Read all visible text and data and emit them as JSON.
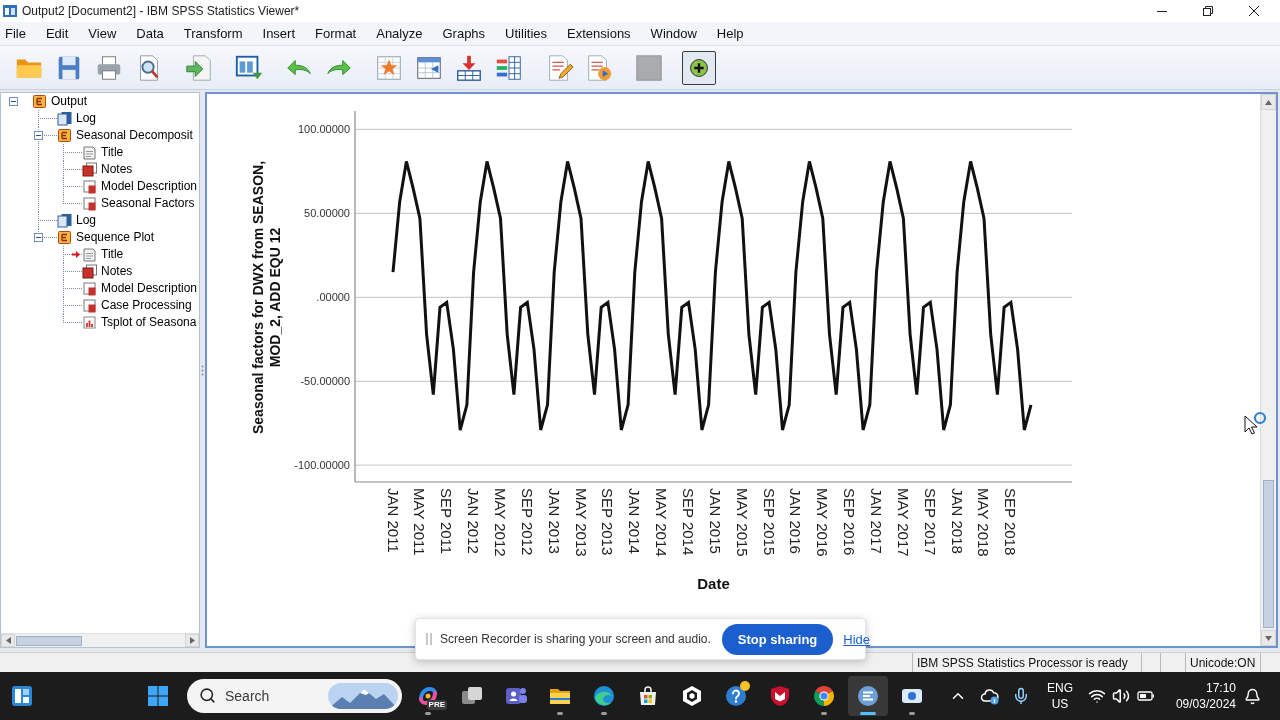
{
  "window": {
    "title": "Output2 [Document2] - IBM SPSS Statistics Viewer*"
  },
  "menu": [
    "File",
    "Edit",
    "View",
    "Data",
    "Transform",
    "Insert",
    "Format",
    "Analyze",
    "Graphs",
    "Utilities",
    "Extensions",
    "Window",
    "Help"
  ],
  "toolbar": {
    "groups": [
      {
        "buttons": [
          {
            "kind": "open",
            "disabled": false,
            "pressed": false
          },
          {
            "kind": "save",
            "disabled": false,
            "pressed": false
          },
          {
            "kind": "print",
            "disabled": false,
            "pressed": false
          },
          {
            "kind": "preview",
            "disabled": false,
            "pressed": false
          }
        ]
      },
      {
        "buttons": [
          {
            "kind": "export",
            "disabled": false,
            "pressed": false
          }
        ]
      },
      {
        "buttons": [
          {
            "kind": "window-down",
            "disabled": false,
            "pressed": false
          }
        ]
      },
      {
        "buttons": [
          {
            "kind": "undo",
            "disabled": false,
            "pressed": false
          },
          {
            "kind": "redo",
            "disabled": false,
            "pressed": false
          }
        ]
      },
      {
        "buttons": [
          {
            "kind": "star-table",
            "disabled": false,
            "pressed": false
          },
          {
            "kind": "grid-arrow",
            "disabled": false,
            "pressed": false
          },
          {
            "kind": "insert-down",
            "disabled": false,
            "pressed": false
          },
          {
            "kind": "variables",
            "disabled": false,
            "pressed": false
          }
        ]
      },
      {
        "buttons": [
          {
            "kind": "edit-doc",
            "disabled": false,
            "pressed": false
          },
          {
            "kind": "play-doc",
            "disabled": false,
            "pressed": false
          }
        ]
      },
      {
        "buttons": [
          {
            "kind": "panel",
            "disabled": true,
            "pressed": false
          }
        ]
      },
      {
        "buttons": [
          {
            "kind": "plus",
            "disabled": false,
            "pressed": true
          }
        ]
      }
    ]
  },
  "outline": [
    {
      "label": "Output",
      "kind": "heading",
      "expanded": true,
      "current": false,
      "children": [
        {
          "label": "Log",
          "kind": "log",
          "current": false
        },
        {
          "label": "Seasonal Decomposit",
          "kind": "heading",
          "expanded": true,
          "current": false,
          "children": [
            {
              "label": "Title",
              "kind": "title",
              "current": false
            },
            {
              "label": "Notes",
              "kind": "notes",
              "current": false
            },
            {
              "label": "Model Description",
              "kind": "table",
              "current": false
            },
            {
              "label": "Seasonal Factors",
              "kind": "table",
              "current": false
            }
          ]
        },
        {
          "label": "Log",
          "kind": "log",
          "current": false
        },
        {
          "label": "Sequence Plot",
          "kind": "heading",
          "expanded": true,
          "current": false,
          "children": [
            {
              "label": "Title",
              "kind": "title",
              "current": true
            },
            {
              "label": "Notes",
              "kind": "notes",
              "current": false
            },
            {
              "label": "Model Description",
              "kind": "table",
              "current": false
            },
            {
              "label": "Case Processing",
              "kind": "table",
              "current": false
            },
            {
              "label": "Tsplot of Seasona",
              "kind": "chart",
              "current": false
            }
          ]
        }
      ]
    }
  ],
  "chart": {
    "chart_data": {
      "type": "line",
      "xlabel": "Date",
      "ylabel": "Seasonal factors for DWX from SEASON, MOD_2, ADD EQU 12",
      "ylim": [
        -110,
        111
      ],
      "grid": true,
      "yticks": [
        {
          "value": 100,
          "label": "100.00000"
        },
        {
          "value": 50,
          "label": "50.00000"
        },
        {
          "value": 0,
          "label": ".00000"
        },
        {
          "value": -50,
          "label": "-50.00000"
        },
        {
          "value": -100,
          "label": "-100.00000"
        }
      ],
      "categories": [
        "JAN 2011",
        null,
        null,
        null,
        "MAY 2011",
        null,
        null,
        null,
        "SEP 2011",
        null,
        null,
        null,
        "JAN 2012",
        null,
        null,
        null,
        "MAY 2012",
        null,
        null,
        null,
        "SEP 2012",
        null,
        null,
        null,
        "JAN 2013",
        null,
        null,
        null,
        "MAY 2013",
        null,
        null,
        null,
        "SEP 2013",
        null,
        null,
        null,
        "JAN 2014",
        null,
        null,
        null,
        "MAY 2014",
        null,
        null,
        null,
        "SEP 2014",
        null,
        null,
        null,
        "JAN 2015",
        null,
        null,
        null,
        "MAY 2015",
        null,
        null,
        null,
        "SEP 2015",
        null,
        null,
        null,
        "JAN 2016",
        null,
        null,
        null,
        "MAY 2016",
        null,
        null,
        null,
        "SEP 2016",
        null,
        null,
        null,
        "JAN 2017",
        null,
        null,
        null,
        "MAY 2017",
        null,
        null,
        null,
        "SEP 2017",
        null,
        null,
        null,
        "JAN 2018",
        null,
        null,
        null,
        "MAY 2018",
        null,
        null,
        null,
        "SEP 2018",
        null,
        null,
        null
      ],
      "values": [
        15,
        57,
        81,
        65,
        47,
        -22,
        -58,
        -6,
        -3,
        -31,
        -79,
        -64,
        15,
        57,
        81,
        65,
        47,
        -22,
        -58,
        -6,
        -3,
        -31,
        -79,
        -64,
        15,
        57,
        81,
        65,
        47,
        -22,
        -58,
        -6,
        -3,
        -31,
        -79,
        -64,
        15,
        57,
        81,
        65,
        47,
        -22,
        -58,
        -6,
        -3,
        -31,
        -79,
        -64,
        15,
        57,
        81,
        65,
        47,
        -22,
        -58,
        -6,
        -3,
        -31,
        -79,
        -64,
        15,
        57,
        81,
        65,
        47,
        -22,
        -58,
        -6,
        -3,
        -31,
        -79,
        -64,
        15,
        57,
        81,
        65,
        47,
        -22,
        -58,
        -6,
        -3,
        -31,
        -79,
        -64,
        15,
        57,
        81,
        65,
        47,
        -22,
        -58,
        -6,
        -3,
        -31,
        -79,
        -64
      ]
    }
  },
  "status_bar": {
    "message": "IBM SPSS Statistics Processor is ready",
    "encoding": "Unicode:ON"
  },
  "share_notice": {
    "message": "Screen Recorder is sharing your screen and audio.",
    "stop_button": "Stop sharing",
    "hide_link": "Hide"
  },
  "taskbar": {
    "search": {
      "placeholder": "Search"
    },
    "apps": [
      {
        "kind": "swirl",
        "badge": "PRE",
        "running": true,
        "selected": false,
        "alert": false
      },
      {
        "kind": "stack",
        "running": false,
        "selected": false,
        "alert": false
      },
      {
        "kind": "chat",
        "running": false,
        "selected": false,
        "alert": false
      },
      {
        "kind": "folder",
        "running": true,
        "selected": false,
        "alert": false
      },
      {
        "kind": "wave",
        "running": true,
        "selected": false,
        "alert": false
      },
      {
        "kind": "bag",
        "running": false,
        "selected": false,
        "alert": false
      },
      {
        "kind": "hexagon",
        "running": false,
        "selected": false,
        "alert": false
      },
      {
        "kind": "question",
        "running": false,
        "selected": false,
        "alert": true
      },
      {
        "kind": "shield",
        "running": false,
        "selected": false,
        "alert": false
      },
      {
        "kind": "ring",
        "running": true,
        "selected": false,
        "alert": false
      },
      {
        "kind": "sigma",
        "running": true,
        "selected": true,
        "alert": false
      },
      {
        "kind": "camera",
        "running": true,
        "selected": false,
        "alert": false
      }
    ],
    "tray": {
      "language": "ENG",
      "region": "US",
      "time": "17:10",
      "date": "09/03/2024"
    }
  }
}
